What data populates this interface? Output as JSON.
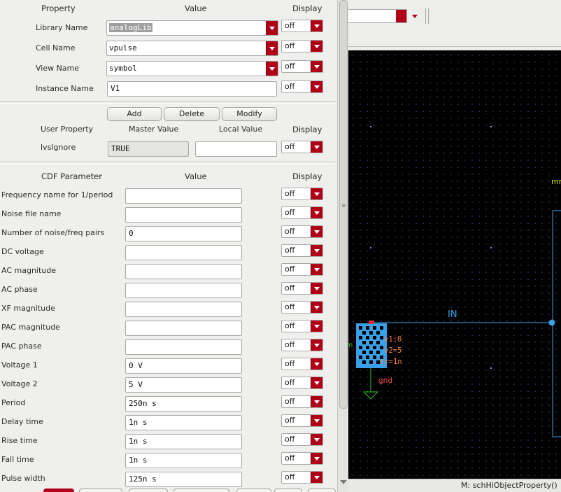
{
  "property_section": {
    "headers": {
      "property": "Property",
      "value": "Value",
      "display": "Display"
    },
    "rows": [
      {
        "label": "Library Name",
        "value": "analogLib",
        "display": "off"
      },
      {
        "label": "Cell Name",
        "value": "vpulse",
        "display": "off"
      },
      {
        "label": "View Name",
        "value": "symbol",
        "display": "off"
      },
      {
        "label": "Instance Name",
        "value": "V1",
        "display": "off"
      }
    ]
  },
  "user_property_section": {
    "buttons": {
      "add": "Add",
      "delete": "Delete",
      "modify": "Modify"
    },
    "headers": {
      "user_property": "User Property",
      "master_value": "Master Value",
      "local_value": "Local Value",
      "display": "Display"
    },
    "rows": [
      {
        "label": "lvsIgnore",
        "master": "TRUE",
        "local": "",
        "display": "off"
      }
    ]
  },
  "cdf_section": {
    "headers": {
      "parameter": "CDF Parameter",
      "value": "Value",
      "display": "Display"
    },
    "rows": [
      {
        "label": "Frequency name for 1/period",
        "value": "",
        "display": "off"
      },
      {
        "label": "Noise file name",
        "value": "",
        "display": "off"
      },
      {
        "label": "Number of noise/freq pairs",
        "value": "0",
        "display": "off"
      },
      {
        "label": "DC voltage",
        "value": "",
        "display": "off"
      },
      {
        "label": "AC magnitude",
        "value": "",
        "display": "off"
      },
      {
        "label": "AC phase",
        "value": "",
        "display": "off"
      },
      {
        "label": "XF magnitude",
        "value": "",
        "display": "off"
      },
      {
        "label": "PAC magnitude",
        "value": "",
        "display": "off"
      },
      {
        "label": "PAC phase",
        "value": "",
        "display": "off"
      },
      {
        "label": "Voltage 1",
        "value": "0 V",
        "display": "off"
      },
      {
        "label": "Voltage 2",
        "value": "5 V",
        "display": "off"
      },
      {
        "label": "Period",
        "value": "250n s",
        "display": "off"
      },
      {
        "label": "Delay time",
        "value": "1n s",
        "display": "off"
      },
      {
        "label": "Rise time",
        "value": "1n s",
        "display": "off"
      },
      {
        "label": "Fall time",
        "value": "1n s",
        "display": "off"
      },
      {
        "label": "Pulse width",
        "value": "125n s",
        "display": "off"
      }
    ]
  },
  "schematic": {
    "net_label": "IN",
    "instance_labels": [
      "v1:0",
      "v2=5",
      "tr=1n"
    ],
    "pin_label": "n",
    "gnd_label": "gnd",
    "edge_label": "mm"
  },
  "status_bar": {
    "mouse_hint": "M: schHiObjectProperty()"
  },
  "colors": {
    "accent_red": "#b00018",
    "wire": "#3aa0e8",
    "instance_label": "#ff8040",
    "gnd": "#28c828",
    "canvas": "#000000"
  }
}
